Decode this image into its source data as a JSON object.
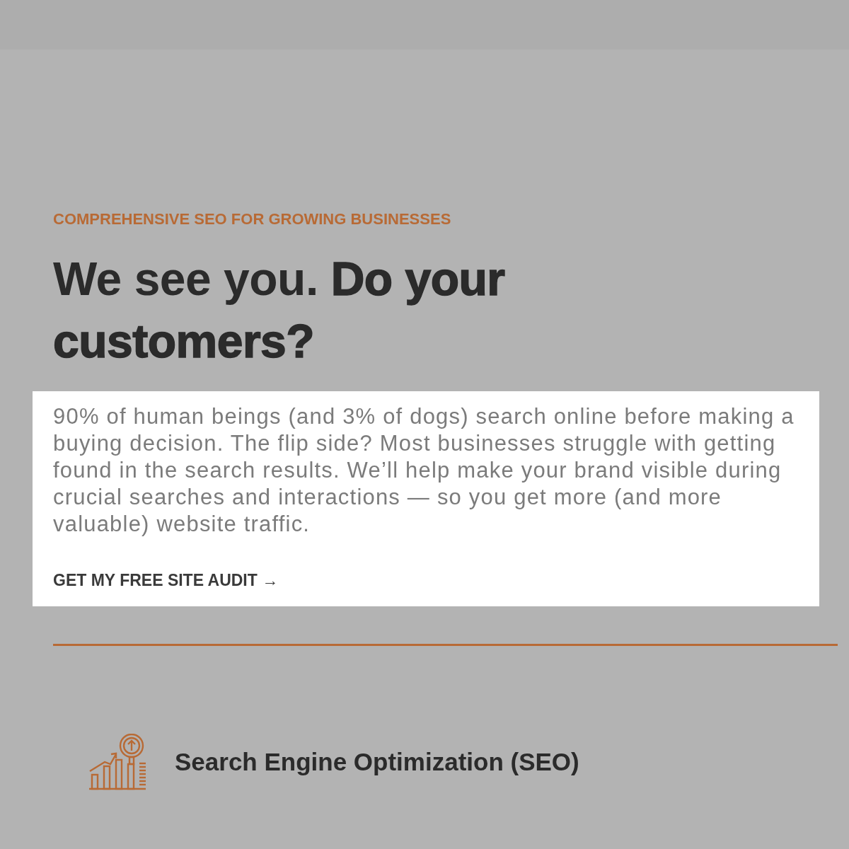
{
  "hero": {
    "eyebrow": "COMPREHENSIVE SEO FOR GROWING BUSINESSES",
    "heading": "We see you. **Do your customers?**",
    "highlight": {
      "paragraph": "90% of human beings (and 3% of dogs) search online before making a buying decision. The flip side? Most businesses struggle with getting found in the search results. We’ll help make your brand visible during crucial searches and interactions — so you get more (and more valuable) website traffic.",
      "cta": "GET MY FREE SITE AUDIT →"
    }
  },
  "services": [
    {
      "title": "Search Engine Optimization (SEO)"
    }
  ]
}
